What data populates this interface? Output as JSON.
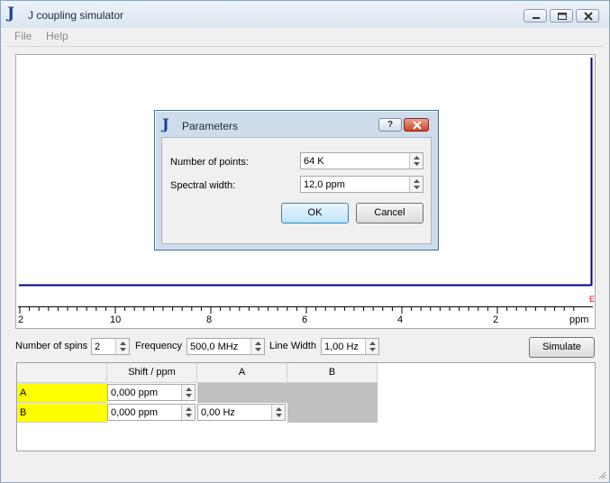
{
  "window": {
    "title": "J coupling simulator",
    "icon_glyph": "J"
  },
  "menu": {
    "items": [
      "File",
      "Help"
    ]
  },
  "spectrum": {
    "x_labels": [
      "2",
      "10",
      "8",
      "6",
      "4",
      "2"
    ],
    "unit_label": "ppm",
    "line_color": "#00008b",
    "marker_glyph": "E"
  },
  "controls": {
    "spins_label": "Number of spins",
    "spins_value": "2",
    "frequency_label": "Frequency",
    "frequency_value": "500,0 MHz",
    "linewidth_label": "Line Width",
    "linewidth_value": "1,00 Hz",
    "simulate_label": "Simulate"
  },
  "table": {
    "headers": [
      "Shift / ppm",
      "A",
      "B"
    ],
    "rows": [
      {
        "label": "A",
        "shift": "0,000 ppm"
      },
      {
        "label": "B",
        "shift": "0,000 ppm",
        "coupling_a": "0,00 Hz"
      }
    ],
    "rowhead_color": "#ffff00"
  },
  "dialog": {
    "title": "Parameters",
    "icon_glyph": "J",
    "help_glyph": "?",
    "points_label": "Number of points:",
    "points_value": "64 K",
    "width_label": "Spectral width:",
    "width_value": "12,0 ppm",
    "ok_label": "OK",
    "cancel_label": "Cancel"
  }
}
